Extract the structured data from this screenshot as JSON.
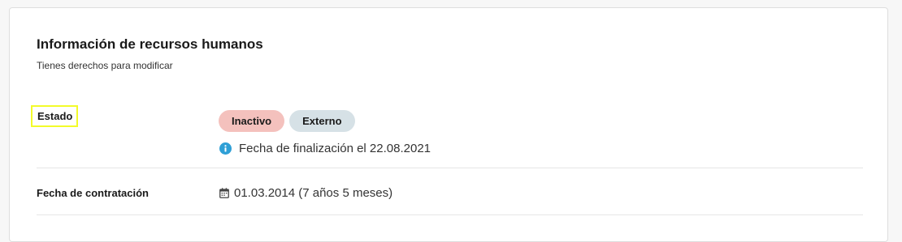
{
  "section": {
    "title": "Información de recursos humanos",
    "subtitle": "Tienes derechos para modificar"
  },
  "estado": {
    "label": "Estado",
    "badges": [
      {
        "text": "Inactivo",
        "color": "#f4c1bd"
      },
      {
        "text": "Externo",
        "color": "#d6e1e6"
      }
    ],
    "info_icon": "info-circle-icon",
    "info_color": "#2e9fd6",
    "end_date_note": "Fecha de finalización el 22.08.2021"
  },
  "hire": {
    "label": "Fecha de contratación",
    "icon": "calendar-icon",
    "value": "01.03.2014 (7 años 5 meses)"
  },
  "highlight_color": "#f3fb2a"
}
